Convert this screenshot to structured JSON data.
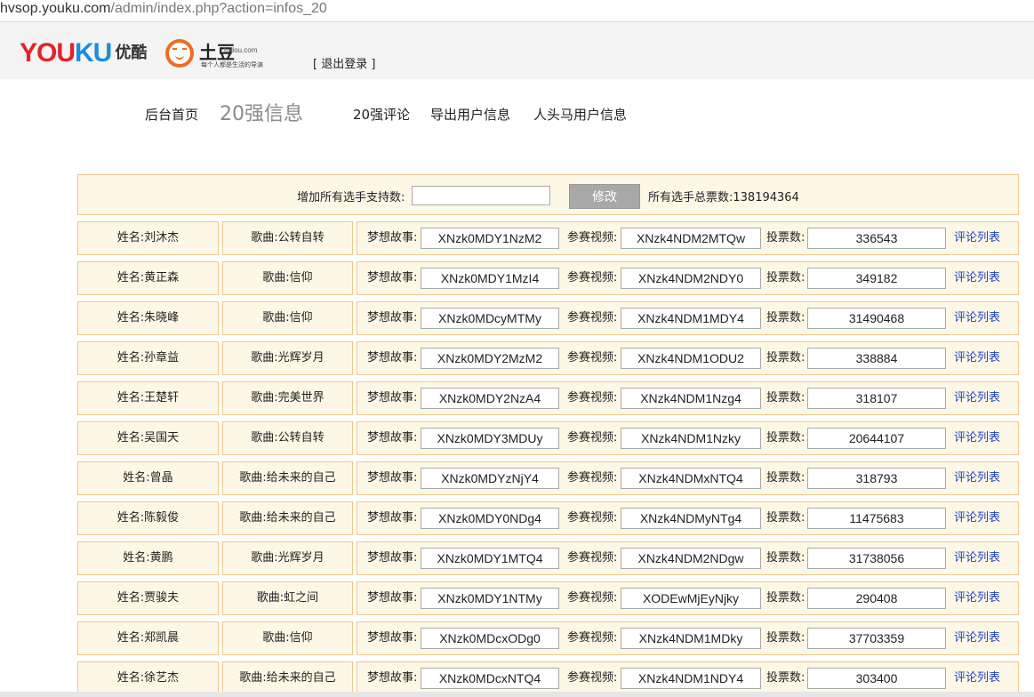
{
  "browser": {
    "url_host": "hvsop.youku.com",
    "url_path": "/admin/index.php?action=infos_20"
  },
  "header": {
    "youku_logo_text_red": "YOU",
    "youku_logo_text_blue": "KU",
    "youku_logo_cn": "优酷",
    "tudou_logo_cn": "土豆",
    "tudou_logo_sub": "tudou.com",
    "tudou_slogan": "每个人都是生活的导演",
    "logout": "[ 退出登录 ]"
  },
  "nav": {
    "items": [
      {
        "label": "后台首页"
      },
      {
        "label": "20强信息"
      },
      {
        "label": "20强评论"
      },
      {
        "label": "导出用户信息"
      },
      {
        "label": "人头马用户信息"
      }
    ]
  },
  "controls": {
    "support_label": "增加所有选手支持数:",
    "support_value": "",
    "modify_button": "修改",
    "total_votes": "所有选手总票数:138194364"
  },
  "labels": {
    "dream": "梦想故事:",
    "video": "参赛视频:",
    "votes": "投票数:",
    "comment": "评论列表"
  },
  "contestants": [
    {
      "name": "姓名:刘沐杰",
      "song": "歌曲:公转自转",
      "dream": "XNzk0MDY1NzM2",
      "video": "XNzk4NDM2MTQw",
      "votes": "336543"
    },
    {
      "name": "姓名:黄正森",
      "song": "歌曲:信仰",
      "dream": "XNzk0MDY1MzI4",
      "video": "XNzk4NDM2NDY0",
      "votes": "349182"
    },
    {
      "name": "姓名:朱晓峰",
      "song": "歌曲:信仰",
      "dream": "XNzk0MDcyMTMy",
      "video": "XNzk4NDM1MDY4",
      "votes": "31490468"
    },
    {
      "name": "姓名:孙章益",
      "song": "歌曲:光辉岁月",
      "dream": "XNzk0MDY2MzM2",
      "video": "XNzk4NDM1ODU2",
      "votes": "338884"
    },
    {
      "name": "姓名:王楚轩",
      "song": "歌曲:完美世界",
      "dream": "XNzk0MDY2NzA4",
      "video": "XNzk4NDM1Nzg4",
      "votes": "318107"
    },
    {
      "name": "姓名:吴国天",
      "song": "歌曲:公转自转",
      "dream": "XNzk0MDY3MDUy",
      "video": "XNzk4NDM1Nzky",
      "votes": "20644107"
    },
    {
      "name": "姓名:曾晶",
      "song": "歌曲:给未来的自己",
      "dream": "XNzk0MDYzNjY4",
      "video": "XNzk4NDMxNTQ4",
      "votes": "318793"
    },
    {
      "name": "姓名:陈毅俊",
      "song": "歌曲:给未来的自己",
      "dream": "XNzk0MDY0NDg4",
      "video": "XNzk4NDMyNTg4",
      "votes": "11475683"
    },
    {
      "name": "姓名:黄鹏",
      "song": "歌曲:光辉岁月",
      "dream": "XNzk0MDY1MTQ4",
      "video": "XNzk4NDM2NDgw",
      "votes": "31738056"
    },
    {
      "name": "姓名:贾骏夫",
      "song": "歌曲:虹之间",
      "dream": "XNzk0MDY1NTMy",
      "video": "XODEwMjEyNjky",
      "votes": "290408"
    },
    {
      "name": "姓名:郑凯晨",
      "song": "歌曲:信仰",
      "dream": "XNzk0MDcxODg0",
      "video": "XNzk4NDM1MDky",
      "votes": "37703359"
    },
    {
      "name": "姓名:徐艺杰",
      "song": "歌曲:给未来的自己",
      "dream": "XNzk0MDcxNTQ4",
      "video": "XNzk4NDM1NDY4",
      "votes": "303400"
    }
  ]
}
